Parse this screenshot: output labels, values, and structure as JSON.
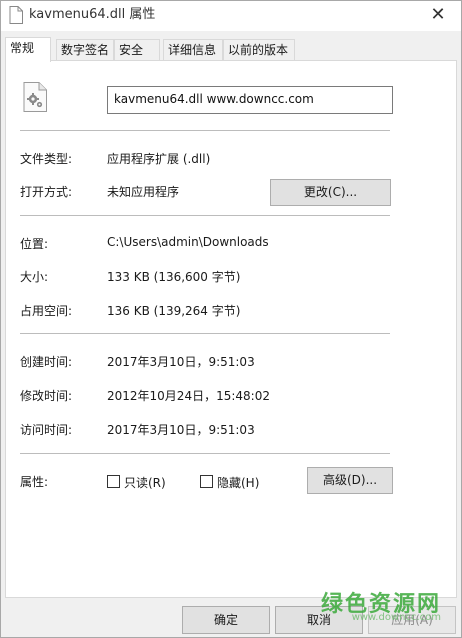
{
  "window": {
    "title": "kavmenu64.dll 属性",
    "close_glyph": "✕"
  },
  "tabs": [
    {
      "label": "常规",
      "active": true
    },
    {
      "label": "数字签名",
      "active": false
    },
    {
      "label": "安全",
      "active": false
    },
    {
      "label": "详细信息",
      "active": false
    },
    {
      "label": "以前的版本",
      "active": false
    }
  ],
  "file": {
    "icon": "dll-gear-file-icon",
    "name_field": "kavmenu64.dll    www.downcc.com"
  },
  "properties": {
    "type": {
      "label": "文件类型:",
      "value": "应用程序扩展 (.dll)"
    },
    "opens_with": {
      "label": "打开方式:",
      "value": "未知应用程序",
      "change_button": "更改(C)..."
    },
    "location": {
      "label": "位置:",
      "value": "C:\\Users\\admin\\Downloads"
    },
    "size": {
      "label": "大小:",
      "value": "133 KB (136,600 字节)"
    },
    "size_on_disk": {
      "label": "占用空间:",
      "value": "136 KB (139,264 字节)"
    },
    "created": {
      "label": "创建时间:",
      "value": "2017年3月10日，9:51:03"
    },
    "modified": {
      "label": "修改时间:",
      "value": "2012年10月24日，15:48:02"
    },
    "accessed": {
      "label": "访问时间:",
      "value": "2017年3月10日，9:51:03"
    },
    "attributes": {
      "label": "属性:",
      "readonly_label": "只读(R)",
      "readonly_checked": false,
      "hidden_label": "隐藏(H)",
      "hidden_checked": false,
      "advanced_button": "高级(D)..."
    }
  },
  "footer": {
    "ok": "确定",
    "cancel": "取消",
    "apply": "应用(A)"
  },
  "watermark": {
    "main": "绿色资源网",
    "sub": "www.downcc.com"
  }
}
